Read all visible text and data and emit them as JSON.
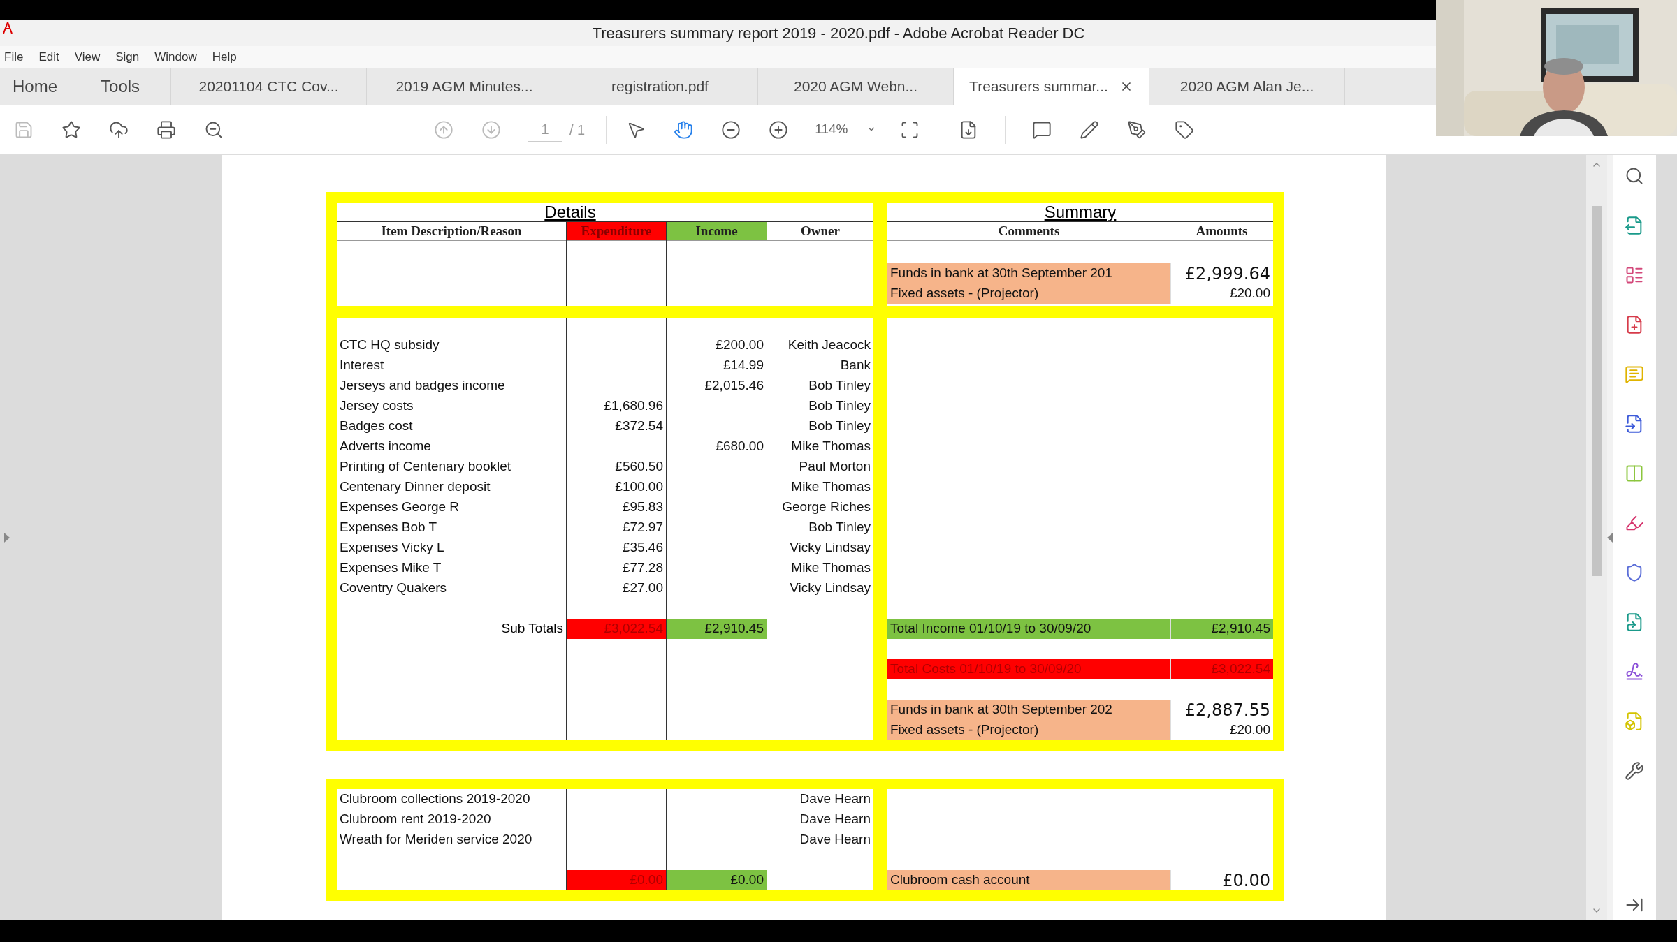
{
  "window": {
    "title": "Treasurers summary report 2019 - 2020.pdf - Adobe Acrobat Reader DC"
  },
  "menu": [
    "File",
    "Edit",
    "View",
    "Sign",
    "Window",
    "Help"
  ],
  "nav_links": [
    "Home",
    "Tools"
  ],
  "tabs": [
    {
      "label": "20201104 CTC Cov...",
      "selected": false
    },
    {
      "label": "2019 AGM Minutes...",
      "selected": false
    },
    {
      "label": "registration.pdf",
      "selected": false
    },
    {
      "label": "2020 AGM  Webn...",
      "selected": false
    },
    {
      "label": "Treasurers summar...",
      "selected": true
    },
    {
      "label": "2020 AGM  Alan Je...",
      "selected": false
    }
  ],
  "toolbar": {
    "page": "1",
    "page_count": "/ 1",
    "zoom": "114%"
  },
  "details": {
    "title": "Details",
    "columns": [
      {
        "label": "Item Description/Reason"
      },
      {
        "label": "Expenditure",
        "color": "#ff0000"
      },
      {
        "label": "Income",
        "color": "#7dc242"
      },
      {
        "label": "Owner"
      }
    ],
    "rows": [
      {
        "description": "CTC HQ subsidy",
        "income": "£200.00",
        "owner": "Keith Jeacock"
      },
      {
        "description": "Interest",
        "income": "£14.99",
        "owner": "Bank"
      },
      {
        "description": "Jerseys and badges income",
        "income": "£2,015.46",
        "owner": "Bob Tinley"
      },
      {
        "description": "Jersey costs",
        "expenditure": "£1,680.96",
        "owner": "Bob Tinley"
      },
      {
        "description": "Badges cost",
        "expenditure": "£372.54",
        "owner": "Bob Tinley"
      },
      {
        "description": "Adverts income",
        "income": "£680.00",
        "owner": "Mike Thomas"
      },
      {
        "description": "Printing of Centenary booklet",
        "expenditure": "£560.50",
        "owner": "Paul Morton"
      },
      {
        "description": "Centenary Dinner deposit",
        "expenditure": "£100.00",
        "owner": "Mike Thomas"
      },
      {
        "description": "Expenses George R",
        "expenditure": "£95.83",
        "owner": "George Riches"
      },
      {
        "description": "Expenses Bob T",
        "expenditure": "£72.97",
        "owner": "Bob Tinley"
      },
      {
        "description": "Expenses Vicky L",
        "expenditure": "£35.46",
        "owner": "Vicky Lindsay"
      },
      {
        "description": "Expenses Mike T",
        "expenditure": "£77.28",
        "owner": "Mike Thomas"
      },
      {
        "description": "Coventry Quakers",
        "expenditure": "£27.00",
        "owner": "Vicky Lindsay"
      }
    ],
    "subtotals": {
      "label": "Sub Totals",
      "expenditure": "£3,022.54",
      "income": "£2,910.45"
    }
  },
  "summary": {
    "title": "Summary",
    "columns": [
      "Comments",
      "Amounts"
    ],
    "opening": [
      {
        "kind": "balance",
        "comment": "Funds in bank at 30th September 201",
        "amount": "£2,999.64",
        "color": "#f6b48a"
      },
      {
        "kind": "asset",
        "comment": "Fixed assets - (Projector)",
        "amount": "£20.00",
        "color": "#f6b48a"
      }
    ],
    "closing": [
      [
        {
          "kind": "total",
          "comment": "Total Income 01/10/19 to 30/09/20",
          "amount": "£2,910.45",
          "color": "#7dc242"
        }
      ],
      [
        {
          "kind": "total",
          "comment": "Total Costs 01/10/19 to 30/09/20",
          "amount": "£3,022.54",
          "color": "#ff0000"
        }
      ],
      [
        {
          "kind": "balance",
          "comment": "Funds in bank at 30th September 202",
          "amount": "£2,887.55",
          "color": "#f6b48a"
        },
        {
          "kind": "asset",
          "comment": "Fixed assets - (Projector)",
          "amount": "£20.00",
          "color": "#f6b48a"
        }
      ]
    ]
  },
  "clubroom": {
    "rows": [
      {
        "description": "Clubroom collections 2019-2020",
        "owner": "Dave Hearn"
      },
      {
        "description": "Clubroom rent 2019-2020",
        "owner": "Dave Hearn"
      },
      {
        "description": "Wreath for Meriden service 2020",
        "owner": "Dave Hearn"
      }
    ],
    "subtotals": {
      "expenditure": "£0.00",
      "income": "£0.00"
    },
    "summary": [
      {
        "kind": "balance",
        "comment": "Clubroom cash account",
        "amount": "£0.00",
        "color": "#f6b48a"
      }
    ]
  }
}
